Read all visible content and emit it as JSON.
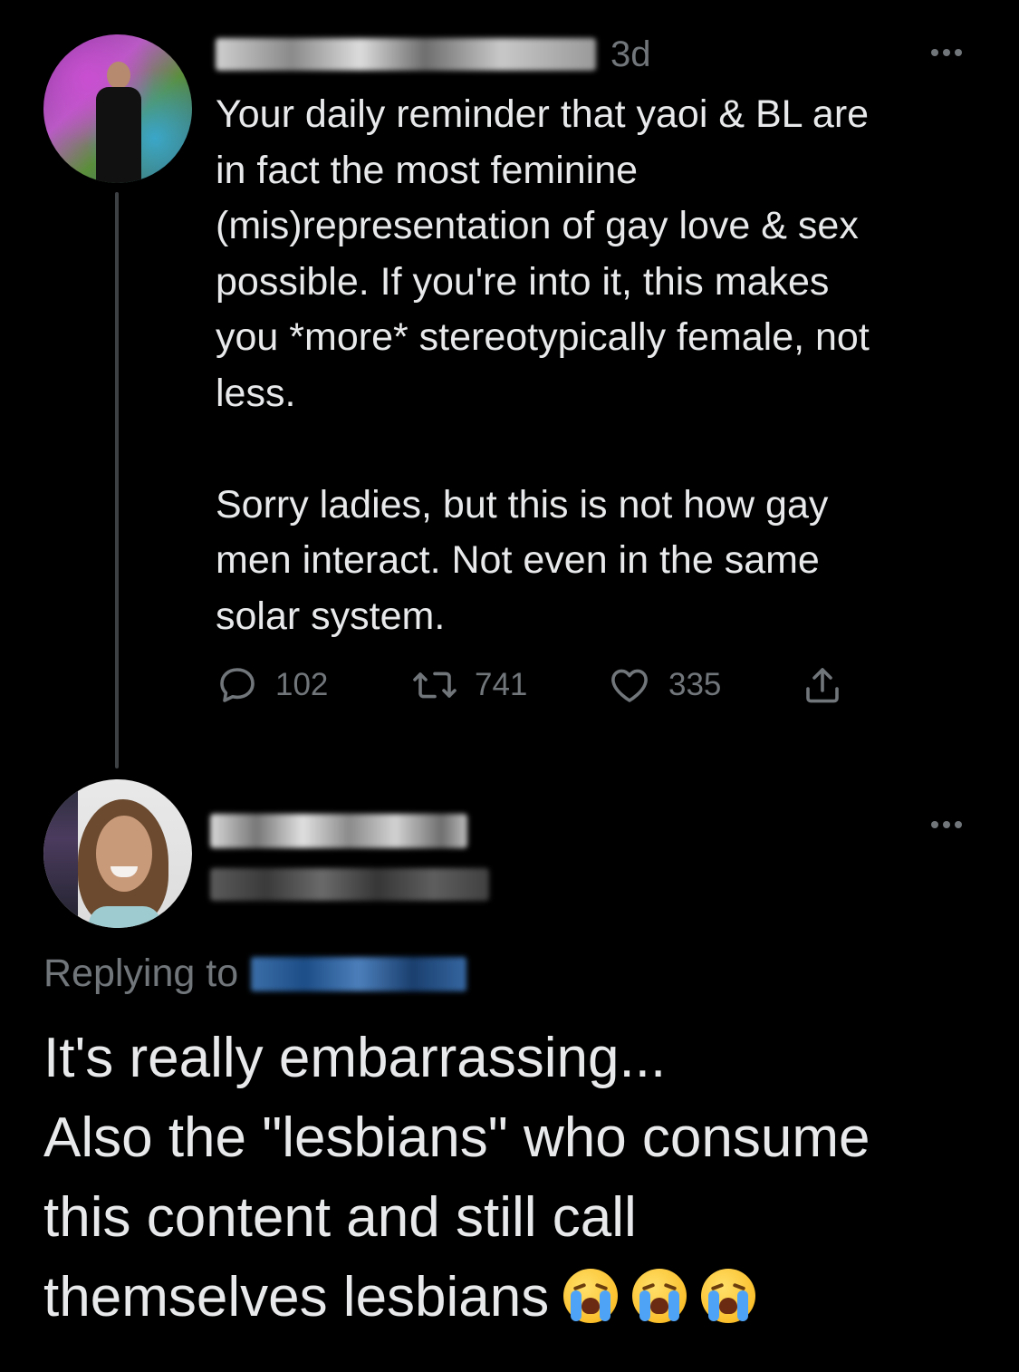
{
  "tweet": {
    "timestamp": "3d",
    "lines": [
      "Your daily reminder that yaoi & BL are",
      "in fact the most feminine",
      "(mis)representation of gay love & sex",
      "possible. If you're into it, this makes",
      "you *more* stereotypically female, not",
      "less."
    ],
    "lines_p2": [
      "Sorry ladies, but this is not how gay",
      "men interact. Not even in the same",
      "solar system."
    ],
    "actions": {
      "replies": "102",
      "retweets": "741",
      "likes": "335"
    }
  },
  "reply": {
    "replying_to_label": "Replying to",
    "lines": [
      "It's really embarrassing...",
      "Also the \"lesbians\" who consume",
      "this content and still call",
      "themselves lesbians"
    ],
    "emoji": [
      "loudly-crying-face",
      "loudly-crying-face",
      "loudly-crying-face"
    ]
  },
  "colors": {
    "background": "#000000",
    "text": "#e7e9ea",
    "secondary_text": "#71767b",
    "thread_line": "#3e4144"
  }
}
